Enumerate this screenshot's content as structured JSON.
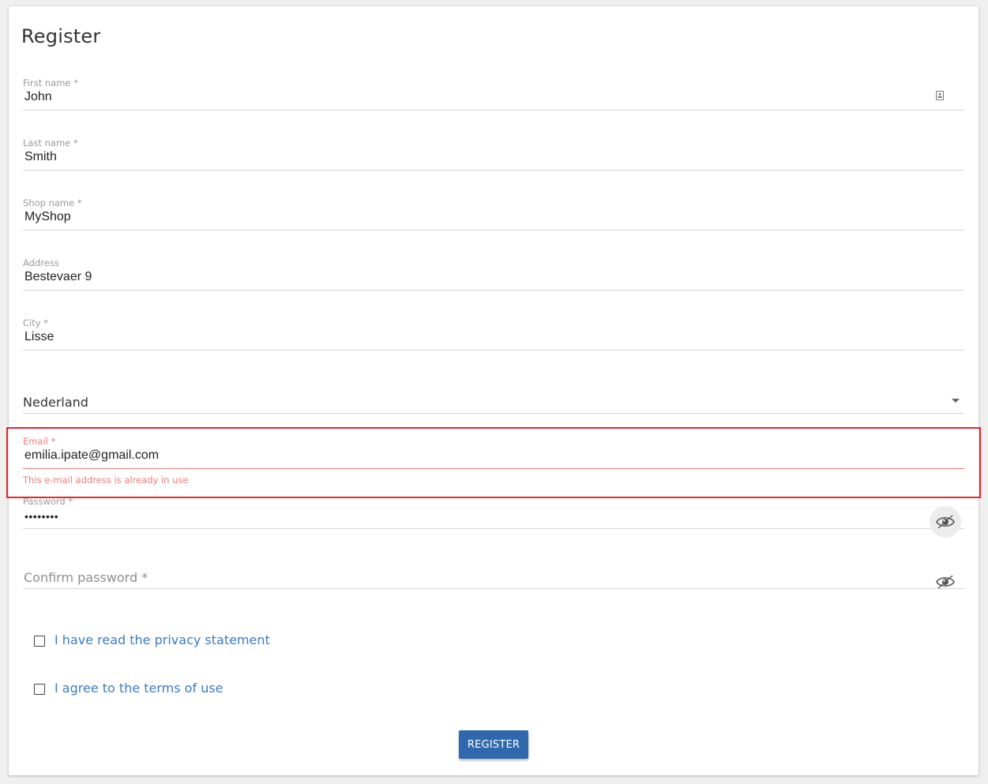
{
  "form": {
    "title": "Register",
    "first_name": {
      "label": "First name *",
      "value": "John"
    },
    "last_name": {
      "label": "Last name *",
      "value": "Smith"
    },
    "shop_name": {
      "label": "Shop name *",
      "value": "MyShop"
    },
    "address": {
      "label": "Address",
      "value": "Bestevaer 9"
    },
    "city": {
      "label": "City *",
      "value": "Lisse"
    },
    "country": {
      "value": "Nederland"
    },
    "email": {
      "label": "Email *",
      "value": "emilia.ipate@gmail.com",
      "error": "This e-mail address is already in use"
    },
    "password": {
      "label": "Password *",
      "value": "••••••••"
    },
    "confirm_password": {
      "placeholder": "Confirm password *",
      "value": ""
    },
    "privacy_label": "I have read the privacy statement",
    "terms_label": "I agree to the terms of use",
    "register_label": "REGISTER"
  },
  "colors": {
    "primary": "#2f68ad",
    "link": "#3a7cc4",
    "error": "#ef7b7b",
    "highlight": "#e8242b"
  },
  "icons": {
    "contact": "contact-card-icon",
    "visibility": "eye-icon",
    "dropdown": "chevron-down-icon"
  }
}
